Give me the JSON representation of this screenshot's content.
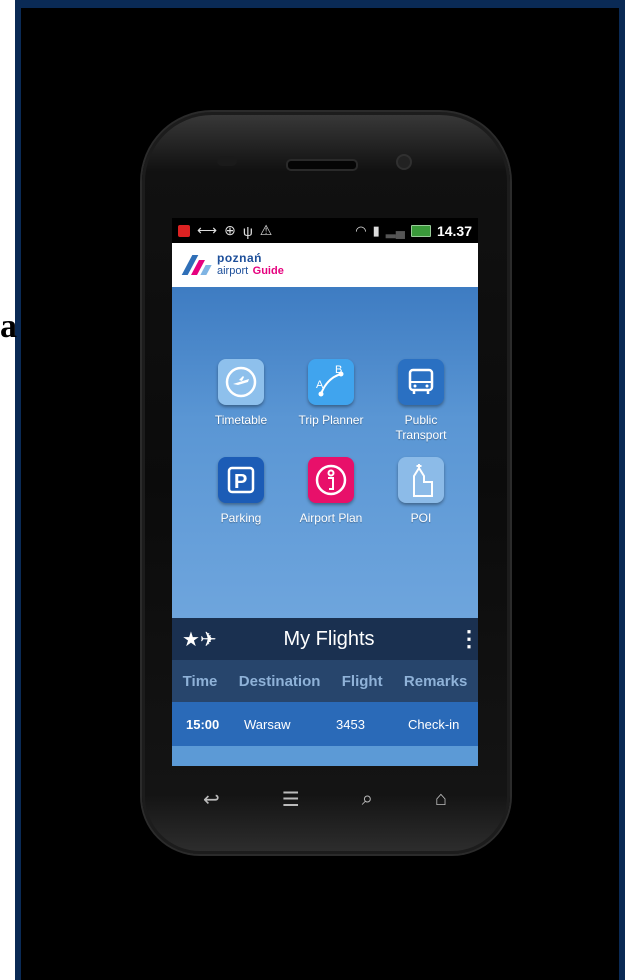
{
  "edge_letter": "a",
  "status_bar": {
    "time": "14.37",
    "icons": [
      "notification-icon",
      "usb-link-icon",
      "download-icon",
      "usb-icon",
      "warning-icon",
      "wifi-icon",
      "sd-card-icon",
      "signal-icon",
      "battery-icon"
    ]
  },
  "app_header": {
    "logo_line1": "poznań",
    "logo_line2": "airport",
    "logo_guide": "Guide"
  },
  "tiles": [
    {
      "label": "Timetable",
      "icon": "clock-plane-icon",
      "color": "#8ec0ec"
    },
    {
      "label": "Trip Planner",
      "icon": "route-ab-icon",
      "color": "#40a4ee"
    },
    {
      "label": "Public\nTransport",
      "icon": "bus-icon",
      "color": "#2a70c2"
    },
    {
      "label": "Parking",
      "icon": "parking-icon",
      "color": "#1c5cb6"
    },
    {
      "label": "Airport Plan",
      "icon": "info-icon",
      "color": "#e8106a"
    },
    {
      "label": "POI",
      "icon": "church-icon",
      "color": "#8cbbe8"
    }
  ],
  "my_flights": {
    "title": "My Flights",
    "columns": [
      "Time",
      "Destination",
      "Flight",
      "Remarks"
    ],
    "rows": [
      {
        "time": "15:00",
        "destination": "Warsaw",
        "flight": "3453",
        "remarks": "Check-in"
      }
    ]
  },
  "nav": {
    "icons": [
      "back-icon",
      "menu-icon",
      "search-icon",
      "home-icon"
    ]
  },
  "colors": {
    "frame": "#0a2a55",
    "screen_blue": "#5c9ad6",
    "flights_bar": "#1a3050",
    "accent_pink": "#e6007e"
  }
}
